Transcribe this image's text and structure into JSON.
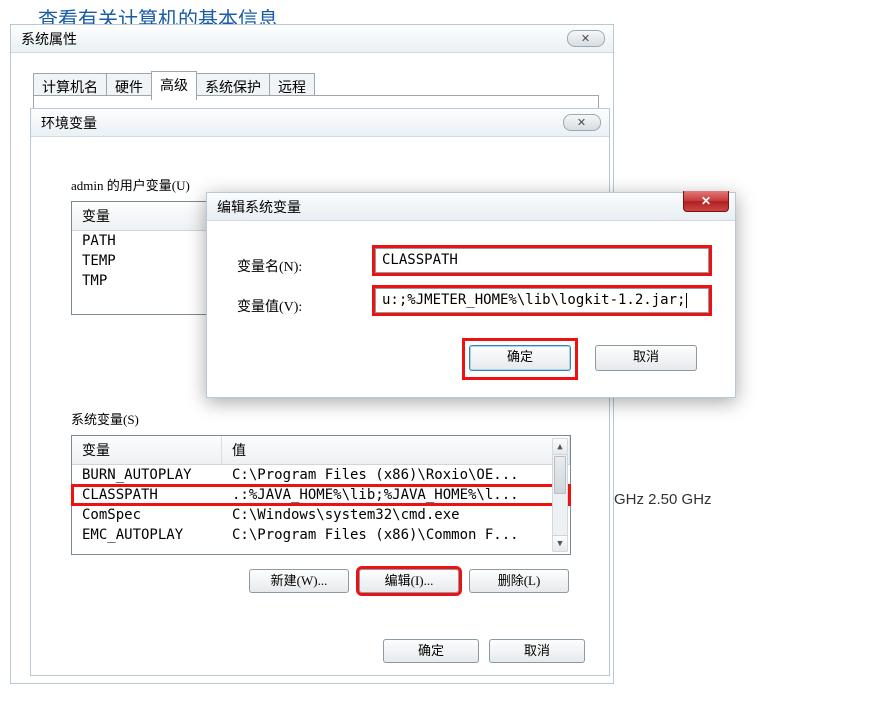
{
  "bg": {
    "title": "查看有关计算机的基本信息",
    "ghz": "GHz  2.50 GHz"
  },
  "sysprops": {
    "title": "系统属性",
    "tabs": {
      "t0": "计算机名",
      "t1": "硬件",
      "t2": "高级",
      "t3": "系统保护",
      "t4": "远程"
    }
  },
  "env": {
    "title": "环境变量",
    "userGroup": "admin 的用户变量(U)",
    "sysGroup": "系统变量(S)",
    "hdrVar": "变量",
    "hdrVal": "值",
    "userRows": {
      "r0": "PATH",
      "r1": "TEMP",
      "r2": "TMP"
    },
    "sysRows": {
      "r0n": "BURN_AUTOPLAY",
      "r0v": "C:\\Program Files (x86)\\Roxio\\OE...",
      "r1n": "CLASSPATH",
      "r1v": ".:%JAVA_HOME%\\lib;%JAVA_HOME%\\l...",
      "r2n": "ComSpec",
      "r2v": "C:\\Windows\\system32\\cmd.exe",
      "r3n": "EMC_AUTOPLAY",
      "r3v": "C:\\Program Files (x86)\\Common F..."
    },
    "btnNew": "新建(W)...",
    "btnEdit": "编辑(I)...",
    "btnDel": "删除(L)",
    "btnOk": "确定",
    "btnCancel": "取消"
  },
  "editvar": {
    "title": "编辑系统变量",
    "lblName": "变量名(N):",
    "lblVal": "变量值(V):",
    "valName": "CLASSPATH",
    "valVal": "u:;%JMETER_HOME%\\lib\\logkit-1.2.jar;",
    "btnOk": "确定",
    "btnCancel": "取消"
  }
}
